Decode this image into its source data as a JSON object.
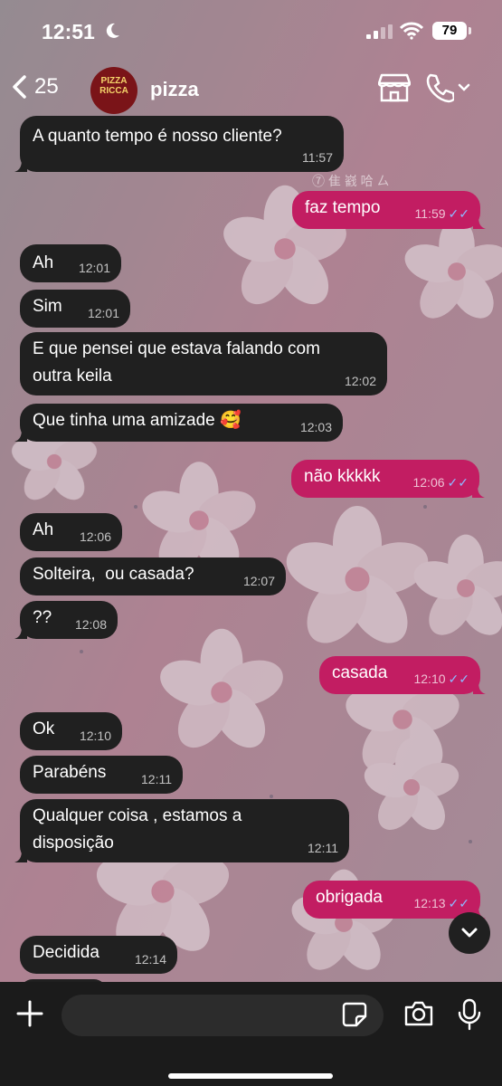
{
  "status": {
    "time": "12:51",
    "battery": "79"
  },
  "header": {
    "back_count": "25",
    "contact_name": "pizza",
    "avatar_text": "PIZZA RICCA"
  },
  "wallpaper_caption": "⑦ 隹 巀 哈 ㄙ",
  "messages": [
    {
      "dir": "in",
      "text": "A quanto tempo é nosso cliente?",
      "time": "11:57"
    },
    {
      "dir": "out",
      "text": "faz tempo",
      "time": "11:59"
    },
    {
      "dir": "in",
      "text": "Ah",
      "time": "12:01"
    },
    {
      "dir": "in",
      "text": "Sim",
      "time": "12:01"
    },
    {
      "dir": "in",
      "text_line1": "E que pensei que estava falando com",
      "text_line2": "outra keila",
      "time": "12:02"
    },
    {
      "dir": "in",
      "text": "Que tinha uma amizade 🥰",
      "time": "12:03"
    },
    {
      "dir": "out",
      "text": "não kkkkk",
      "time": "12:06"
    },
    {
      "dir": "in",
      "text": "Ah",
      "time": "12:06"
    },
    {
      "dir": "in",
      "text": "Solteira,  ou casada?",
      "time": "12:07"
    },
    {
      "dir": "in",
      "text": "??",
      "time": "12:08"
    },
    {
      "dir": "out",
      "text": "casada",
      "time": "12:10"
    },
    {
      "dir": "in",
      "text": "Ok",
      "time": "12:10"
    },
    {
      "dir": "in",
      "text": "Parabéns",
      "time": "12:11"
    },
    {
      "dir": "in",
      "text_line1": "Qualquer coisa , estamos a",
      "text_line2": "disposição",
      "time": "12:11"
    },
    {
      "dir": "out",
      "text": "obrigada",
      "time": "12:13"
    },
    {
      "dir": "in",
      "text": "Decidida",
      "time": "12:14"
    }
  ],
  "colors": {
    "incoming": "#202020",
    "outgoing": "#c21d62",
    "read_ticks": "#8fb8ff"
  },
  "icons": [
    "back-chevron-icon",
    "moon-icon",
    "signal-icon",
    "wifi-icon",
    "shop-icon",
    "phone-icon",
    "chevron-down-icon",
    "plus-icon",
    "sticker-icon",
    "camera-icon",
    "mic-icon"
  ]
}
